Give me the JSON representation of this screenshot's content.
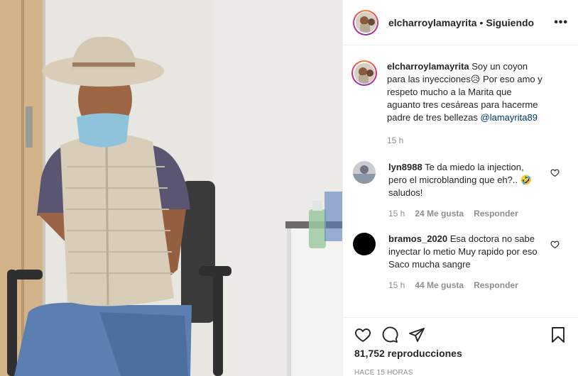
{
  "header": {
    "username": "elcharroylamayrita",
    "separator": "•",
    "follow_status": "Siguiendo",
    "more_label": "•••"
  },
  "caption": {
    "username": "elcharroylamayrita",
    "text": "Soy un coyon para las inyecciones😥 Por eso amo y respeto mucho a la Marita que aguanto tres cesáreas para hacerme padre de tres bellezas ",
    "mention": "@lamayrita89",
    "time": "15 h"
  },
  "comments": [
    {
      "username": "lyn8988",
      "text": "Te da miedo la injection, pero el microblanding que eh?.. 🤣 saludos!",
      "time": "15 h",
      "likes": "24 Me gusta",
      "reply": "Responder"
    },
    {
      "username": "bramos_2020",
      "text": "Esa doctora no sabe inyectar lo metio Muy rapido por eso Saco mucha sangre",
      "time": "15 h",
      "likes": "44 Me gusta",
      "reply": "Responder"
    }
  ],
  "footer": {
    "views_count": "81,752",
    "views_label": "reproducciones",
    "posted": "HACE 15 HORAS"
  },
  "icons": {
    "like": "heart-icon",
    "comment": "comment-bubble-icon",
    "share": "paper-plane-icon",
    "save": "bookmark-icon"
  }
}
